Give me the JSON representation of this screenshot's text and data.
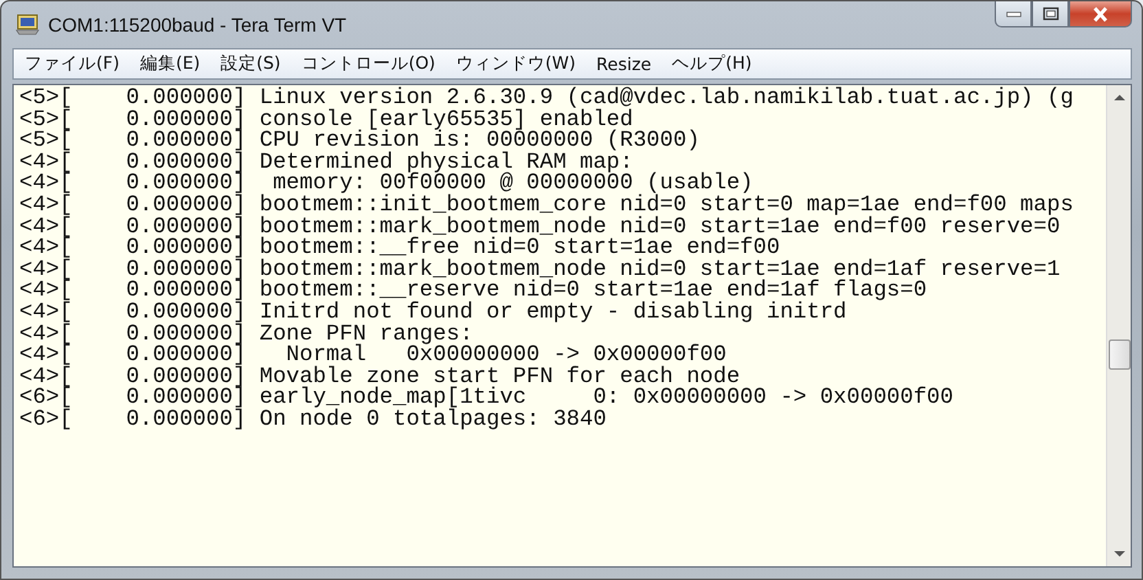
{
  "window": {
    "title": "COM1:115200baud - Tera Term VT"
  },
  "menu": [
    {
      "label": "ファイル(F)"
    },
    {
      "label": "編集(E)"
    },
    {
      "label": "設定(S)"
    },
    {
      "label": "コントロール(O)"
    },
    {
      "label": "ウィンドウ(W)"
    },
    {
      "label": "Resize"
    },
    {
      "label": "ヘルプ(H)"
    }
  ],
  "terminal": {
    "lines": [
      "<5>[    0.000000] Linux version 2.6.30.9 (cad@vdec.lab.namikilab.tuat.ac.jp) (g",
      "<5>[    0.000000] console [early65535] enabled",
      "<5>[    0.000000] CPU revision is: 00000000 (R3000)",
      "<4>[    0.000000] Determined physical RAM map:",
      "<4>[    0.000000]  memory: 00f00000 @ 00000000 (usable)",
      "<4>[    0.000000] bootmem::init_bootmem_core nid=0 start=0 map=1ae end=f00 maps",
      "<4>[    0.000000] bootmem::mark_bootmem_node nid=0 start=1ae end=f00 reserve=0",
      "<4>[    0.000000] bootmem::__free nid=0 start=1ae end=f00",
      "<4>[    0.000000] bootmem::mark_bootmem_node nid=0 start=1ae end=1af reserve=1",
      "<4>[    0.000000] bootmem::__reserve nid=0 start=1ae end=1af flags=0",
      "<4>[    0.000000] Initrd not found or empty - disabling initrd",
      "<4>[    0.000000] Zone PFN ranges:",
      "<4>[    0.000000]   Normal   0x00000000 -> 0x00000f00",
      "<4>[    0.000000] Movable zone start PFN for each node",
      "<6>[    0.000000] early_node_map[1tivc     0: 0x00000000 -> 0x00000f00",
      "<6>[    0.000000] On node 0 totalpages: 3840"
    ]
  }
}
